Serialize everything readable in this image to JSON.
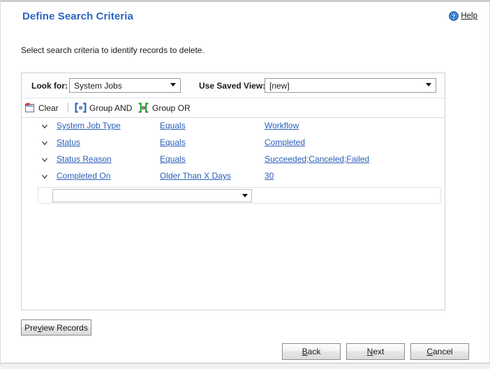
{
  "header": {
    "title": "Define Search Criteria",
    "help_label": "Help",
    "help_icon": "help-circle-icon"
  },
  "instruction": "Select search criteria to identify records to delete.",
  "criteria_panel": {
    "look_for": {
      "label": "Look for:",
      "value": "System Jobs"
    },
    "saved_view": {
      "label": "Use Saved View:",
      "value": "[new]"
    },
    "toolbar": {
      "clear_label": "Clear",
      "clear_icon": "clear-filter-icon",
      "group_and_label": "Group AND",
      "group_and_icon": "group-and-brackets-icon",
      "group_or_label": "Group OR",
      "group_or_icon": "group-or-brackets-icon"
    },
    "rows": [
      {
        "chevron_icon": "chevron-down-icon",
        "field": "System Job Type",
        "operator": "Equals",
        "value": "Workflow"
      },
      {
        "chevron_icon": "chevron-down-icon",
        "field": "Status",
        "operator": "Equals",
        "value": "Completed"
      },
      {
        "chevron_icon": "chevron-down-icon",
        "field": "Status Reason",
        "operator": "Equals",
        "value": "Succeeded;Canceled;Failed"
      },
      {
        "chevron_icon": "chevron-down-icon",
        "field": "Completed On",
        "operator": "Older Than X Days",
        "value": "30"
      }
    ],
    "new_row": {
      "value": "",
      "placeholder": ""
    }
  },
  "buttons": {
    "preview_records": "Preview Records",
    "back": "Back",
    "next": "Next",
    "cancel": "Cancel"
  },
  "status_bar": {
    "item_1": "",
    "item_2": "",
    "item_3": ""
  },
  "colors": {
    "title_blue": "#2b66c2",
    "link_blue": "#2b5fb8",
    "panel_border": "#ccd0d6",
    "group_and_green": "#2b66c2",
    "group_or_green": "#28a028",
    "clear_red": "#d33a2f"
  }
}
